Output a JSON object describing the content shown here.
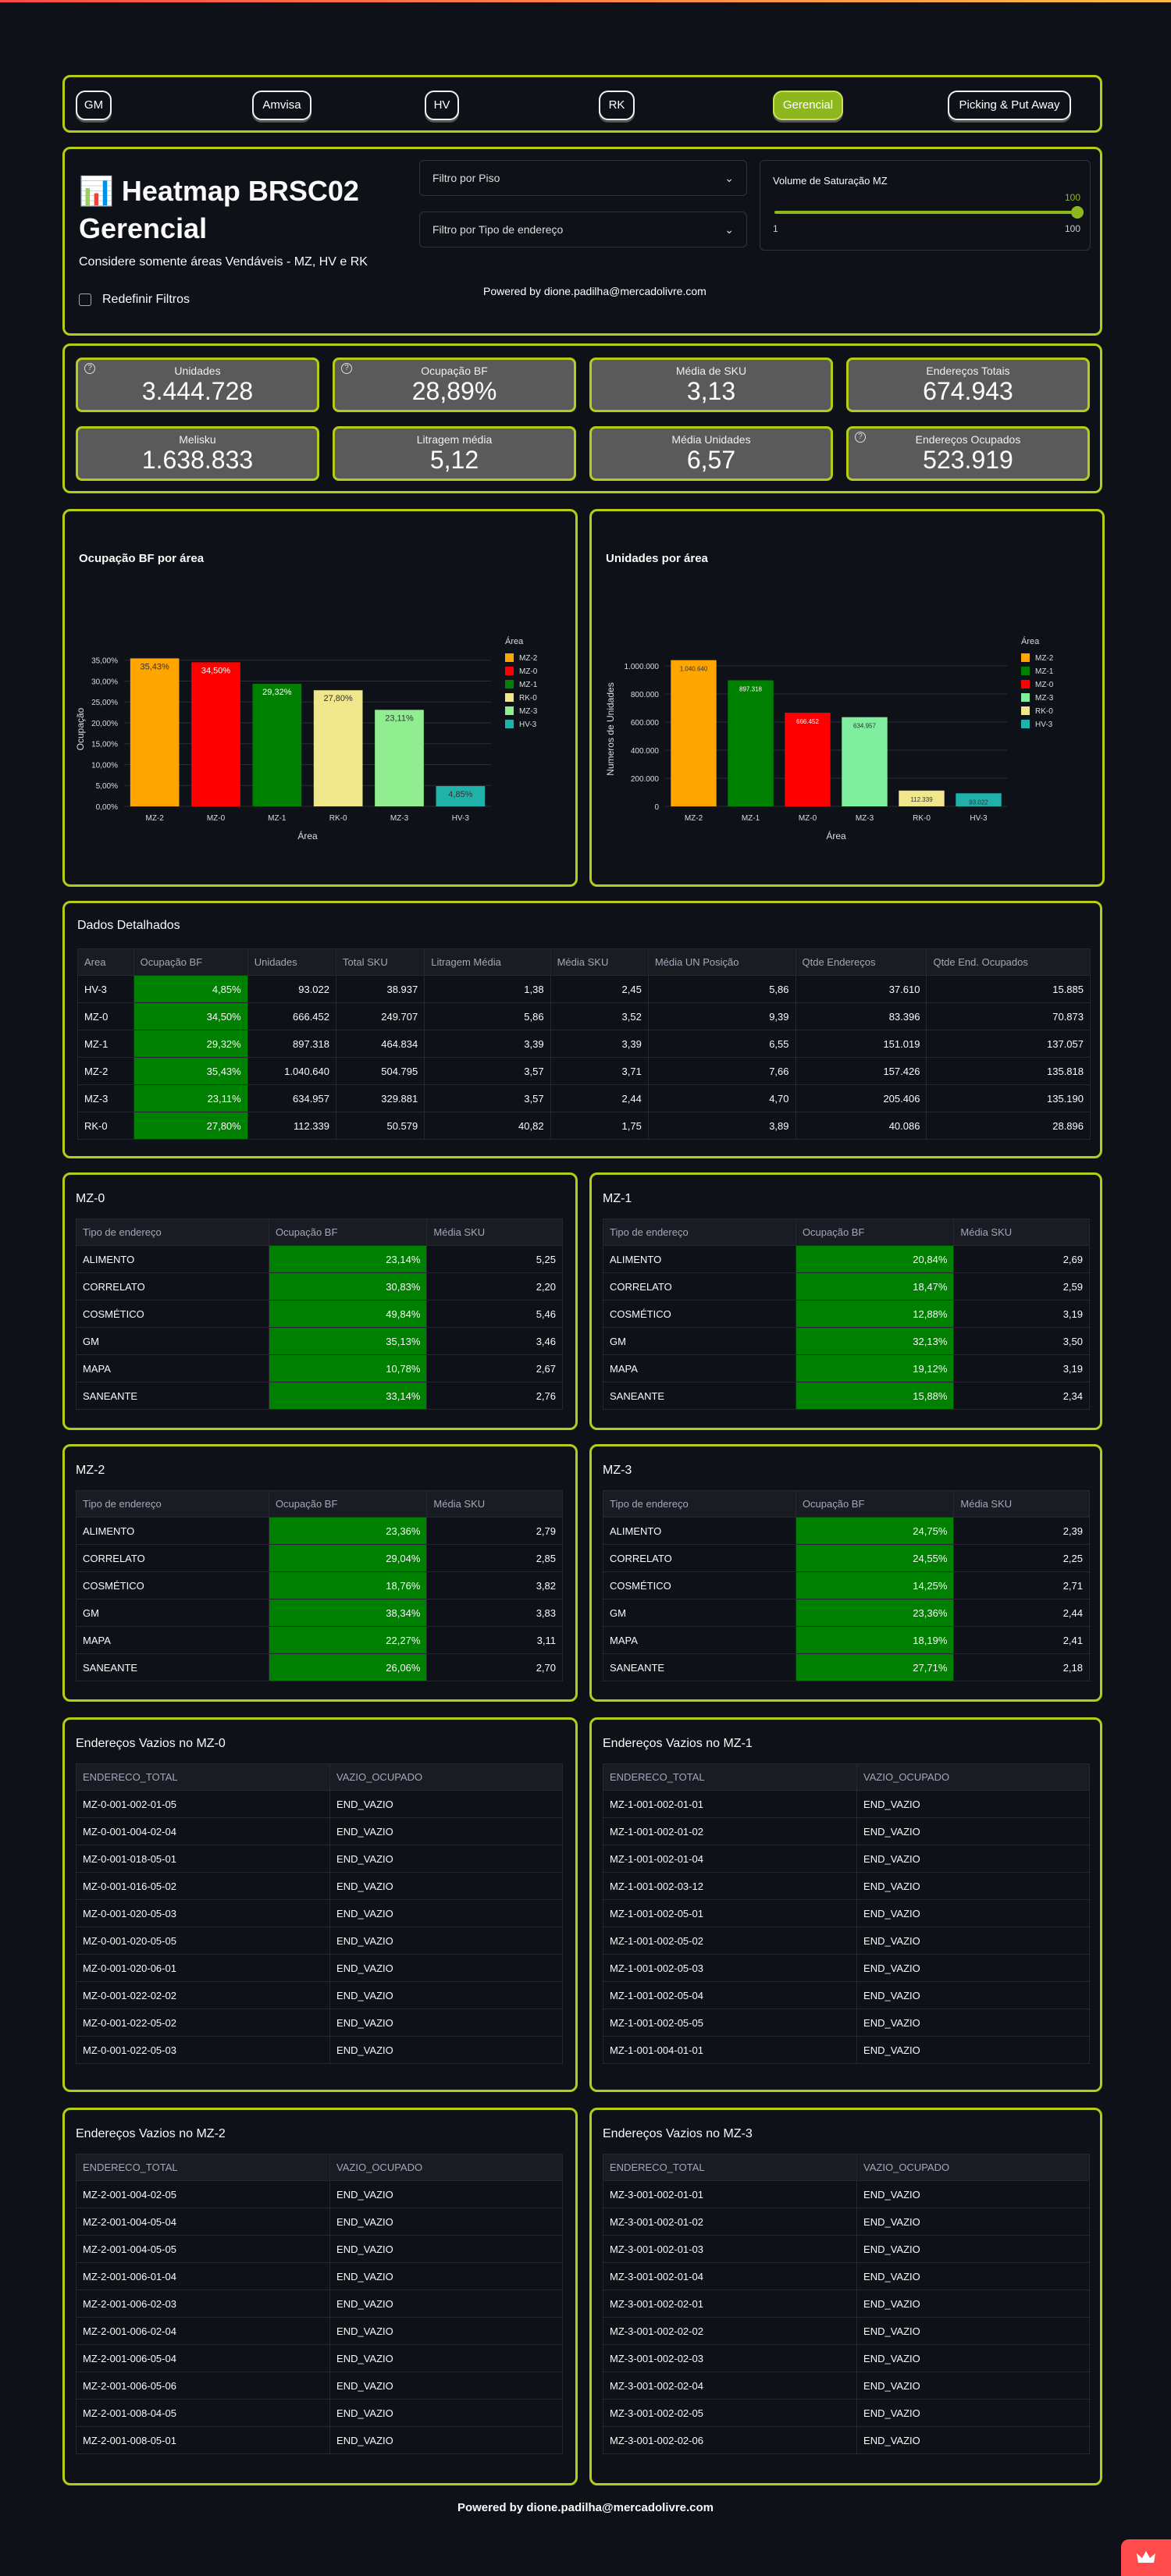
{
  "nav": [
    "GM",
    "Amvisa",
    "HV",
    "RK",
    "Gerencial",
    "Picking & Put Away"
  ],
  "header": {
    "title": "📊 Heatmap BRSC02 Gerencial",
    "subtitle": "Considere somente áreas Vendáveis - MZ, HV e RK",
    "reset": "Redefinir Filtros",
    "filter_floor": "Filtro por Piso",
    "filter_type": "Filtro por Tipo de endereço",
    "slider_label": "Volume de Saturação MZ",
    "slider_value": "100",
    "slider_min": "1",
    "slider_max": "100",
    "slider_fraction": 1.0,
    "powered": "Powered by dione.padilha@mercadolivre.com"
  },
  "kpis": [
    {
      "label": "Unidades",
      "value": "3.444.728",
      "help": true
    },
    {
      "label": "Ocupação BF",
      "value": "28,89%",
      "help": true
    },
    {
      "label": "Média de SKU",
      "value": "3,13",
      "help": false
    },
    {
      "label": "Endereços Totais",
      "value": "674.943",
      "help": false
    },
    {
      "label": "Melisku",
      "value": "1.638.833",
      "help": false
    },
    {
      "label": "Litragem média",
      "value": "5,12",
      "help": false
    },
    {
      "label": "Média Unidades",
      "value": "6,57",
      "help": false
    },
    {
      "label": "Endereços Ocupados",
      "value": "523.919",
      "help": true
    }
  ],
  "chart_data": [
    {
      "type": "bar",
      "title": "Ocupação BF por área",
      "xlabel": "Área",
      "ylabel": "Ocupação",
      "legend_title": "Área",
      "legend_position": "right",
      "ylim": [
        0,
        37
      ],
      "yticks": [
        "0,00%",
        "5,00%",
        "10,00%",
        "15,00%",
        "20,00%",
        "25,00%",
        "30,00%",
        "35,00%"
      ],
      "ytick_values": [
        0,
        5,
        10,
        15,
        20,
        25,
        30,
        35
      ],
      "categories": [
        "MZ-2",
        "MZ-0",
        "MZ-1",
        "RK-0",
        "MZ-3",
        "HV-3"
      ],
      "values": [
        35.43,
        34.5,
        29.32,
        27.8,
        23.11,
        4.85
      ],
      "labels": [
        "35,43%",
        "34,50%",
        "29,32%",
        "27,80%",
        "23,11%",
        "4,85%"
      ],
      "colors": [
        "#ffa500",
        "#ff0000",
        "#008000",
        "#f0e68c",
        "#90ee90",
        "#20b2aa"
      ]
    },
    {
      "type": "bar",
      "title": "Unidades por área",
      "xlabel": "Área",
      "ylabel": "Numeros de Unidades",
      "legend_title": "Área",
      "legend_position": "right",
      "ylim": [
        0,
        1100000
      ],
      "yticks": [
        "0",
        "200.000",
        "400.000",
        "600.000",
        "800.000",
        "1.000.000"
      ],
      "ytick_values": [
        0,
        200000,
        400000,
        600000,
        800000,
        1000000
      ],
      "categories": [
        "MZ-2",
        "MZ-1",
        "MZ-0",
        "MZ-3",
        "RK-0",
        "HV-3"
      ],
      "values": [
        1040640,
        897318,
        666452,
        634957,
        112339,
        93022
      ],
      "labels": [
        "1.040.640",
        "897.318",
        "666.452",
        "634.957",
        "112.339",
        "93.022"
      ],
      "colors": [
        "#ffa500",
        "#008000",
        "#ff0000",
        "#7fee9f",
        "#f0e68c",
        "#20b2aa"
      ]
    }
  ],
  "details": {
    "title": "Dados Detalhados",
    "headers": [
      "Area",
      "Ocupação BF",
      "Unidades",
      "Total SKU",
      "Litragem Média",
      "Média SKU",
      "Média UN Posição",
      "Qtde Endereços",
      "Qtde End. Ocupados"
    ],
    "rows": [
      [
        "HV-3",
        "4,85%",
        "93.022",
        "38.937",
        "1,38",
        "2,45",
        "5,86",
        "37.610",
        "15.885"
      ],
      [
        "MZ-0",
        "34,50%",
        "666.452",
        "249.707",
        "5,86",
        "3,52",
        "9,39",
        "83.396",
        "70.873"
      ],
      [
        "MZ-1",
        "29,32%",
        "897.318",
        "464.834",
        "3,39",
        "3,39",
        "6,55",
        "151.019",
        "137.057"
      ],
      [
        "MZ-2",
        "35,43%",
        "1.040.640",
        "504.795",
        "3,57",
        "3,71",
        "7,66",
        "157.426",
        "135.818"
      ],
      [
        "MZ-3",
        "23,11%",
        "634.957",
        "329.881",
        "3,57",
        "2,44",
        "4,70",
        "205.406",
        "135.190"
      ],
      [
        "RK-0",
        "27,80%",
        "112.339",
        "50.579",
        "40,82",
        "1,75",
        "3,89",
        "40.086",
        "28.896"
      ]
    ]
  },
  "mz_tables": [
    {
      "title": "MZ-0",
      "headers": [
        "Tipo de endereço",
        "Ocupação BF",
        "Média SKU"
      ],
      "rows": [
        [
          "ALIMENTO",
          "23,14%",
          "5,25"
        ],
        [
          "CORRELATO",
          "30,83%",
          "2,20"
        ],
        [
          "COSMÉTICO",
          "49,84%",
          "5,46"
        ],
        [
          "GM",
          "35,13%",
          "3,46"
        ],
        [
          "MAPA",
          "10,78%",
          "2,67"
        ],
        [
          "SANEANTE",
          "33,14%",
          "2,76"
        ]
      ]
    },
    {
      "title": "MZ-1",
      "headers": [
        "Tipo de endereço",
        "Ocupação BF",
        "Média SKU"
      ],
      "rows": [
        [
          "ALIMENTO",
          "20,84%",
          "2,69"
        ],
        [
          "CORRELATO",
          "18,47%",
          "2,59"
        ],
        [
          "COSMÉTICO",
          "12,88%",
          "3,19"
        ],
        [
          "GM",
          "32,13%",
          "3,50"
        ],
        [
          "MAPA",
          "19,12%",
          "3,19"
        ],
        [
          "SANEANTE",
          "15,88%",
          "2,34"
        ]
      ]
    },
    {
      "title": "MZ-2",
      "headers": [
        "Tipo de endereço",
        "Ocupação BF",
        "Média SKU"
      ],
      "rows": [
        [
          "ALIMENTO",
          "23,36%",
          "2,79"
        ],
        [
          "CORRELATO",
          "29,04%",
          "2,85"
        ],
        [
          "COSMÉTICO",
          "18,76%",
          "3,82"
        ],
        [
          "GM",
          "38,34%",
          "3,83"
        ],
        [
          "MAPA",
          "22,27%",
          "3,11"
        ],
        [
          "SANEANTE",
          "26,06%",
          "2,70"
        ]
      ]
    },
    {
      "title": "MZ-3",
      "headers": [
        "Tipo de endereço",
        "Ocupação BF",
        "Média SKU"
      ],
      "rows": [
        [
          "ALIMENTO",
          "24,75%",
          "2,39"
        ],
        [
          "CORRELATO",
          "24,55%",
          "2,25"
        ],
        [
          "COSMÉTICO",
          "14,25%",
          "2,71"
        ],
        [
          "GM",
          "23,36%",
          "2,44"
        ],
        [
          "MAPA",
          "18,19%",
          "2,41"
        ],
        [
          "SANEANTE",
          "27,71%",
          "2,18"
        ]
      ]
    }
  ],
  "empty_tables": [
    {
      "title": "Endereços Vazios no MZ-0",
      "headers": [
        "ENDERECO_TOTAL",
        "VAZIO_OCUPADO"
      ],
      "rows": [
        [
          "MZ-0-001-002-01-05",
          "END_VAZIO"
        ],
        [
          "MZ-0-001-004-02-04",
          "END_VAZIO"
        ],
        [
          "MZ-0-001-018-05-01",
          "END_VAZIO"
        ],
        [
          "MZ-0-001-016-05-02",
          "END_VAZIO"
        ],
        [
          "MZ-0-001-020-05-03",
          "END_VAZIO"
        ],
        [
          "MZ-0-001-020-05-05",
          "END_VAZIO"
        ],
        [
          "MZ-0-001-020-06-01",
          "END_VAZIO"
        ],
        [
          "MZ-0-001-022-02-02",
          "END_VAZIO"
        ],
        [
          "MZ-0-001-022-05-02",
          "END_VAZIO"
        ],
        [
          "MZ-0-001-022-05-03",
          "END_VAZIO"
        ]
      ]
    },
    {
      "title": "Endereços Vazios no MZ-1",
      "headers": [
        "ENDERECO_TOTAL",
        "VAZIO_OCUPADO"
      ],
      "rows": [
        [
          "MZ-1-001-002-01-01",
          "END_VAZIO"
        ],
        [
          "MZ-1-001-002-01-02",
          "END_VAZIO"
        ],
        [
          "MZ-1-001-002-01-04",
          "END_VAZIO"
        ],
        [
          "MZ-1-001-002-03-12",
          "END_VAZIO"
        ],
        [
          "MZ-1-001-002-05-01",
          "END_VAZIO"
        ],
        [
          "MZ-1-001-002-05-02",
          "END_VAZIO"
        ],
        [
          "MZ-1-001-002-05-03",
          "END_VAZIO"
        ],
        [
          "MZ-1-001-002-05-04",
          "END_VAZIO"
        ],
        [
          "MZ-1-001-002-05-05",
          "END_VAZIO"
        ],
        [
          "MZ-1-001-004-01-01",
          "END_VAZIO"
        ]
      ]
    },
    {
      "title": "Endereços Vazios no MZ-2",
      "headers": [
        "ENDERECO_TOTAL",
        "VAZIO_OCUPADO"
      ],
      "rows": [
        [
          "MZ-2-001-004-02-05",
          "END_VAZIO"
        ],
        [
          "MZ-2-001-004-05-04",
          "END_VAZIO"
        ],
        [
          "MZ-2-001-004-05-05",
          "END_VAZIO"
        ],
        [
          "MZ-2-001-006-01-04",
          "END_VAZIO"
        ],
        [
          "MZ-2-001-006-02-03",
          "END_VAZIO"
        ],
        [
          "MZ-2-001-006-02-04",
          "END_VAZIO"
        ],
        [
          "MZ-2-001-006-05-04",
          "END_VAZIO"
        ],
        [
          "MZ-2-001-006-05-06",
          "END_VAZIO"
        ],
        [
          "MZ-2-001-008-04-05",
          "END_VAZIO"
        ],
        [
          "MZ-2-001-008-05-01",
          "END_VAZIO"
        ]
      ]
    },
    {
      "title": "Endereços Vazios no MZ-3",
      "headers": [
        "ENDERECO_TOTAL",
        "VAZIO_OCUPADO"
      ],
      "rows": [
        [
          "MZ-3-001-002-01-01",
          "END_VAZIO"
        ],
        [
          "MZ-3-001-002-01-02",
          "END_VAZIO"
        ],
        [
          "MZ-3-001-002-01-03",
          "END_VAZIO"
        ],
        [
          "MZ-3-001-002-01-04",
          "END_VAZIO"
        ],
        [
          "MZ-3-001-002-02-01",
          "END_VAZIO"
        ],
        [
          "MZ-3-001-002-02-02",
          "END_VAZIO"
        ],
        [
          "MZ-3-001-002-02-03",
          "END_VAZIO"
        ],
        [
          "MZ-3-001-002-02-04",
          "END_VAZIO"
        ],
        [
          "MZ-3-001-002-02-05",
          "END_VAZIO"
        ],
        [
          "MZ-3-001-002-02-06",
          "END_VAZIO"
        ]
      ]
    }
  ],
  "footer": "Powered by dione.padilha@mercadolivre.com",
  "colors": {
    "accent": "#b5cc18",
    "active_tab": "#8db81d",
    "cell_green": "#008000",
    "kpi_bg": "#5a5a5a"
  }
}
